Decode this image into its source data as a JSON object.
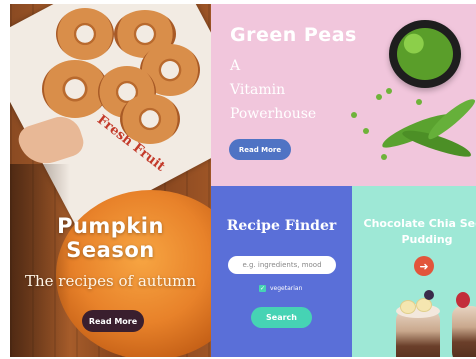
{
  "panels": {
    "pumpkin": {
      "title_line1": "Pumpkin",
      "title_line2": "Season",
      "subtitle": "The recipes of autumn",
      "button_label": "Read More",
      "paper_brand": "Fresh Fruit"
    },
    "peas": {
      "title": "Green Peas",
      "subtitle_lines": [
        "A",
        "Vitamin",
        "Powerhouse"
      ],
      "button_label": "Read More"
    },
    "finder": {
      "title": "Recipe Finder",
      "search_placeholder": "e.g. ingredients, mood",
      "checkbox_label": "vegetarian",
      "checkbox_checked": true,
      "button_label": "Search"
    },
    "chia": {
      "title_line1": "Chocolate Chia Seed",
      "title_line2": "Pudding",
      "arrow_icon": "arrow-right-icon"
    }
  },
  "colors": {
    "peas_bg": "#f1c6dc",
    "finder_bg": "#5a6fd8",
    "chia_bg": "#9ee8d6",
    "button_blue": "#4f73c4",
    "button_teal": "#46d3b4",
    "button_dark": "#3a1f2e",
    "arrow_red": "#e2553b"
  }
}
